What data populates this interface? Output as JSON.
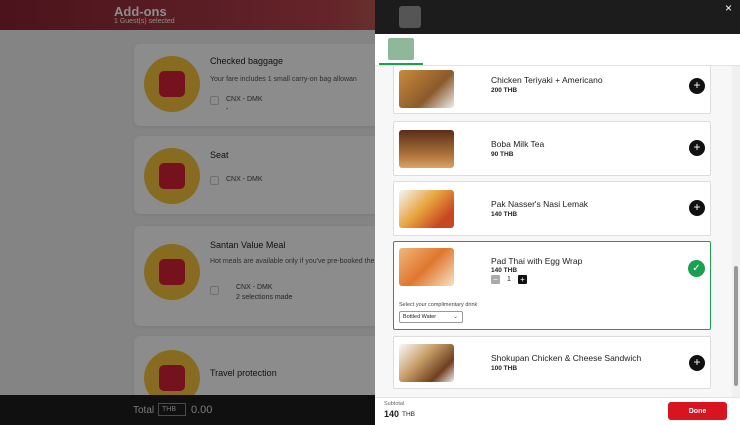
{
  "background": {
    "header": {
      "title": "Add-ons",
      "subtitle": "1 Guest(s) selected"
    },
    "cards": [
      {
        "title": "Checked baggage",
        "text": "Your fare includes 1 small carry-on bag allowan",
        "route": "CNX - DMK",
        "route_sub": "-"
      },
      {
        "title": "Seat",
        "route": "CNX - DMK"
      },
      {
        "title": "Santan Value Meal",
        "text": "Hot meals are available only if you've pre-booked the",
        "route": "CNX - DMK",
        "route_sub": "2 selections made"
      },
      {
        "title": "Travel protection"
      }
    ],
    "footer": {
      "total_label": "Total",
      "currency": "THB",
      "amount": "0.00"
    }
  },
  "drawer": {
    "close_icon": "×",
    "items": [
      {
        "name": "Chicken Teriyaki + Americano",
        "price": "200 THB",
        "add": "+"
      },
      {
        "name": "Boba Milk Tea",
        "price": "90 THB",
        "add": "+"
      },
      {
        "name": "Pak Nasser's Nasi Lemak",
        "price": "140 THB",
        "add": "+"
      },
      {
        "name": "Pad Thai with Egg Wrap",
        "price": "140 THB",
        "check": "✓",
        "minus": "−",
        "qty": "1",
        "plus": "+",
        "drink_label": "Select your complimentary drink",
        "drink_value": "Bottled Water"
      },
      {
        "name": "Shokupan Chicken & Cheese Sandwich",
        "price": "100 THB",
        "add": "+"
      }
    ],
    "footer": {
      "subtotal_label": "Subtotal",
      "subtotal_amount": "140",
      "subtotal_currency": "THB",
      "done_label": "Done"
    }
  },
  "colors": {
    "accent": "#1ba052",
    "done": "#d7141f",
    "dark": "#1c1c1c"
  }
}
